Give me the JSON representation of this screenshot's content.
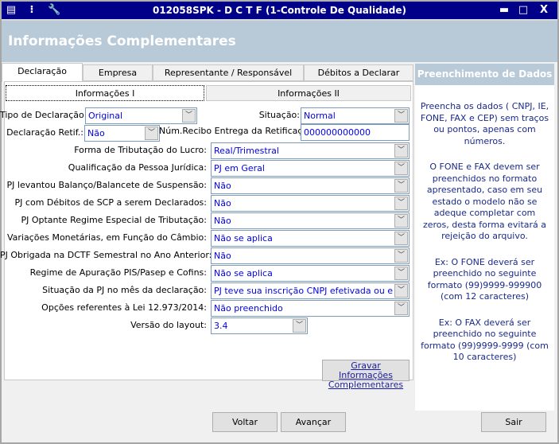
{
  "window": {
    "title": "012058SPK - D C T F (1-Controle De Qualidade)",
    "icons": [
      "menu-icon",
      "traffic-light-icon",
      "wrench-icon"
    ],
    "controls": [
      "minimize-icon",
      "maximize-icon",
      "close-icon"
    ]
  },
  "header": {
    "title": "Informações Complementares"
  },
  "tabs": [
    {
      "label": "Declaração"
    },
    {
      "label": "Empresa"
    },
    {
      "label": "Representante / Responsável"
    },
    {
      "label": "Débitos a Declarar"
    }
  ],
  "subtabs": [
    {
      "label": "Informações I"
    },
    {
      "label": "Informações II"
    }
  ],
  "form": {
    "tipo": {
      "label": "Tipo de Declaração:",
      "value": "Original"
    },
    "situacao": {
      "label": "Situação:",
      "value": "Normal"
    },
    "retif": {
      "label": "Declaração Retif.:",
      "value": "Não"
    },
    "recibo": {
      "label": "Núm.Recibo Entrega da Retificação:",
      "value": "000000000000"
    },
    "rows": [
      {
        "label": "Forma de Tributação do Lucro:",
        "value": "Real/Trimestral"
      },
      {
        "label": "Qualificação da Pessoa Jurídica:",
        "value": "PJ em Geral"
      },
      {
        "label": "PJ levantou Balanço/Balancete de Suspensão:",
        "value": "Não"
      },
      {
        "label": "PJ com Débitos de SCP a serem Declarados:",
        "value": "Não"
      },
      {
        "label": "PJ Optante Regime Especial de Tributação:",
        "value": "Não"
      },
      {
        "label": "Variações Monetárias, em Função do Câmbio:",
        "value": "Não se aplica"
      },
      {
        "label": "PJ Obrigada na DCTF Semestral no Ano Anterior:",
        "value": "Não"
      },
      {
        "label": "Regime de Apuração PIS/Pasep e Cofins:",
        "value": "Não se aplica"
      },
      {
        "label": "Situação da PJ no mês da declaração:",
        "value": "PJ teve sua inscrição CNPJ efetivada ou entrou"
      },
      {
        "label": "Opções referentes à Lei 12.973/2014:",
        "value": "Não preenchido"
      }
    ],
    "versao": {
      "label": "Versão do layout:",
      "value": "3.4"
    },
    "gravar_line1": "Gravar Informações",
    "gravar_line2": "Complementares"
  },
  "help": {
    "title": "Preenchimento de Dados",
    "paragraphs": [
      "Preencha os dados ( CNPJ, IE, FONE, FAX e CEP) sem traços ou pontos, apenas com números.",
      "O FONE e FAX  devem ser preenchidos no formato apresentado, caso em seu estado o modelo não se adeque completar com zeros, desta forma evitará a rejeição do arquivo.",
      "Ex: O FONE deverá ser preenchido no seguinte formato (99)9999-999900  (com 12 caracteres)",
      "Ex: O FAX deverá ser preenchido no seguinte formato (99)9999-9999  (com 10 caracteres)"
    ]
  },
  "buttons": {
    "voltar": "Voltar",
    "avancar": "Avançar",
    "sair": "Sair"
  }
}
